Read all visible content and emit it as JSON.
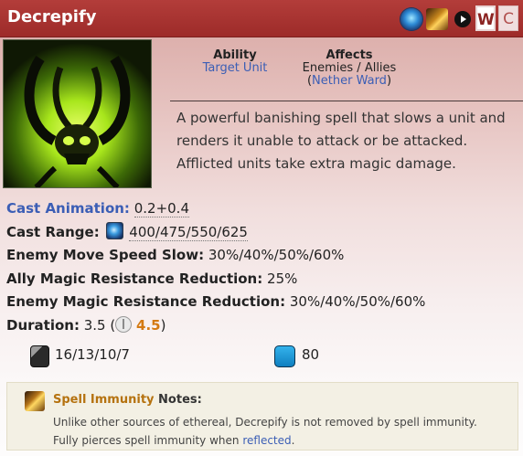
{
  "ability": {
    "name": "Decrepify",
    "title_buttons": {
      "w_label": "W",
      "c_label": "C"
    },
    "title_icons": [
      "ethereal-icon",
      "spell-immunity-icon",
      "play-icon"
    ]
  },
  "meta": {
    "ability_label": "Ability",
    "ability_value": "Target Unit",
    "affects_label": "Affects",
    "affects_value": "Enemies / Allies",
    "affects_paren_open": "(",
    "affects_link": "Nether Ward",
    "affects_paren_close": ")"
  },
  "description": "A powerful banishing spell that slows a unit and renders it unable to attack or be attacked. Afflicted units take extra magic damage.",
  "stats": {
    "cast_animation_label": "Cast Animation:",
    "cast_animation_value": "0.2+0.4",
    "cast_range_label": "Cast Range:",
    "cast_range_value": "400/475/550/625",
    "move_slow_label": "Enemy Move Speed Slow:",
    "move_slow_value": "30%/40%/50%/60%",
    "ally_mr_label": "Ally Magic Resistance Reduction:",
    "ally_mr_value": "25%",
    "enemy_mr_label": "Enemy Magic Resistance Reduction:",
    "enemy_mr_value": "30%/40%/50%/60%",
    "duration_label": "Duration:",
    "duration_value": "3.5",
    "duration_paren_open": "(",
    "duration_talent_value": "4.5",
    "duration_paren_close": ")"
  },
  "costs": {
    "cooldown": "16/13/10/7",
    "mana": "80"
  },
  "notes": {
    "immunity_label": "Spell Immunity",
    "notes_label": "Notes:",
    "line1": "Unlike other sources of ethereal, Decrepify is not removed by spell immunity.",
    "line2_prefix": "Fully pierces spell immunity when",
    "line2_link": "reflected",
    "line2_suffix": "."
  },
  "colors": {
    "title_bar": "#a8322f",
    "link_blue": "#3b5eb5",
    "talent_orange": "#d47a12",
    "immunity_gold": "#b5720f",
    "notes_bg": "#f3f0e4"
  }
}
